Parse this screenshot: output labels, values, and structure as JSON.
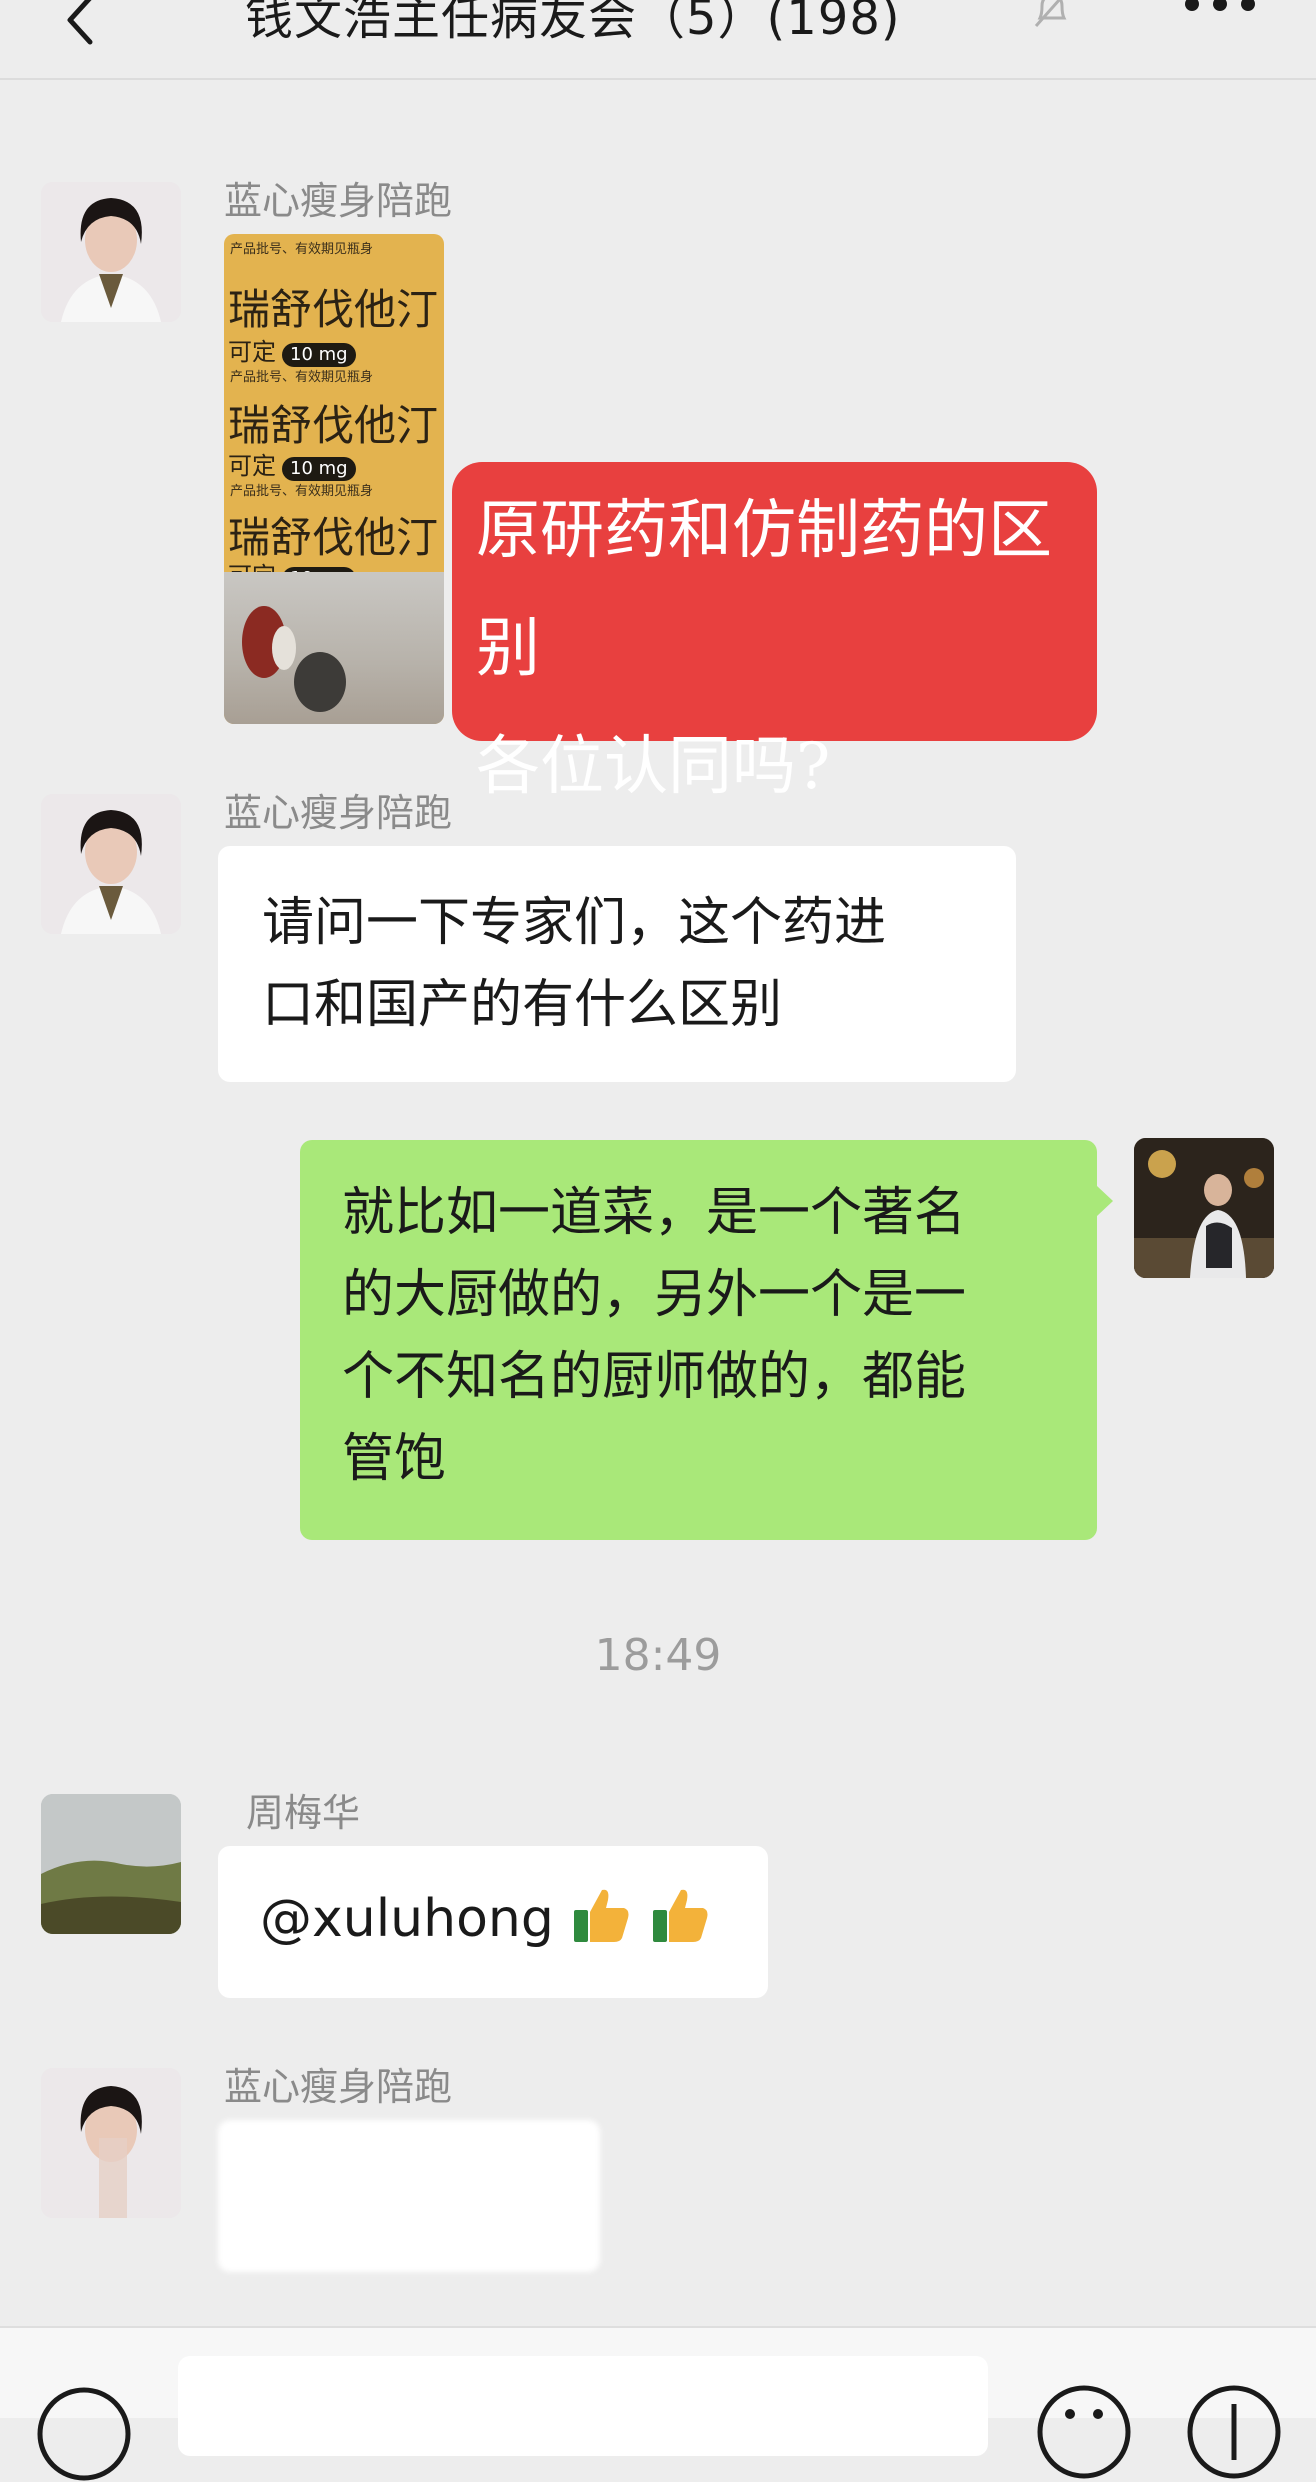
{
  "header": {
    "title": "钱文浩主任病友会（5）(198)",
    "back_icon": "back-chevron-icon",
    "mute_icon": "bell-muted-icon",
    "more_icon": "more-dots-icon"
  },
  "messages": [
    {
      "sender": "蓝心瘦身陪跑",
      "photo": {
        "lines": [
          "瑞舒伐他汀",
          "瑞舒伐他汀",
          "瑞舒伐他汀"
        ],
        "dose": "10 mg",
        "tag_prefix": "可定",
        "fine_print": "产品批号、有效期见瓶身",
        "overlay_lines": [
          "原研药和仿制药的区别",
          "各位认同吗?"
        ]
      }
    },
    {
      "sender": "蓝心瘦身陪跑",
      "lines": [
        "请问一下专家们，这个药进",
        "口和国产的有什么区别"
      ]
    },
    {
      "sender": "self",
      "lines": [
        "就比如一道菜，是一个著名",
        "的大厨做的，另外一个是一",
        "个不知名的厨师做的，都能",
        "管饱"
      ]
    },
    {
      "sender": "周梅华",
      "text": "@xuluhong"
    },
    {
      "sender": "蓝心瘦身陪跑"
    }
  ],
  "timestamp": "18:49",
  "colors": {
    "background": "#ededed",
    "self_bubble": "#a9e879",
    "other_bubble": "#ffffff",
    "overlay_red": "#e8403f"
  },
  "bottom_bar": {
    "voice_icon": "voice-icon",
    "emoji_icon": "emoji-icon",
    "plus_icon": "plus-icon"
  }
}
